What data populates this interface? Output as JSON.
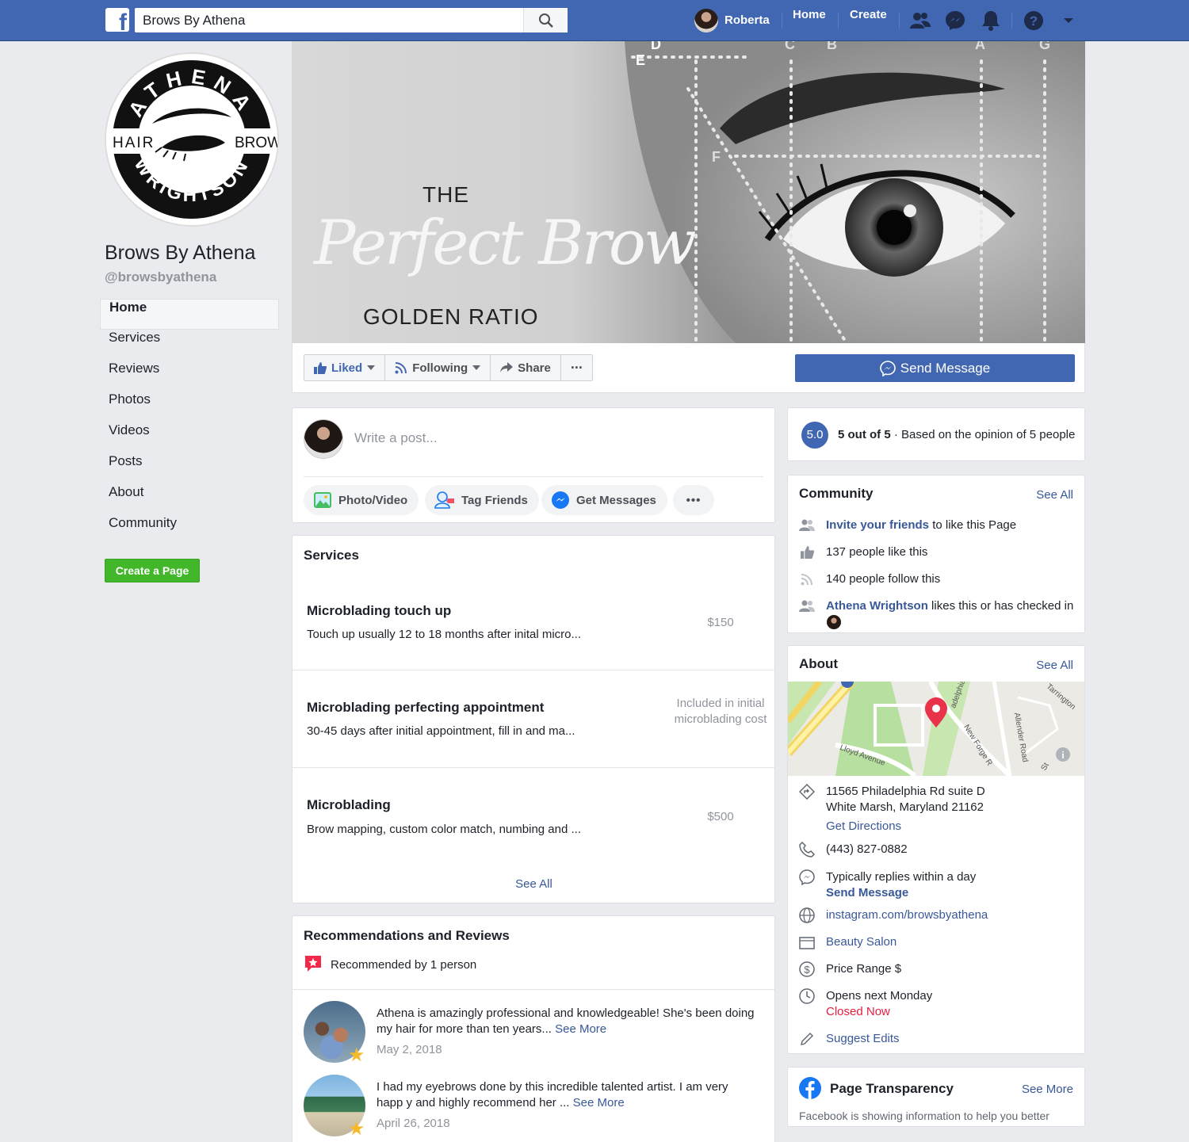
{
  "topbar": {
    "search_value": "Brows By Athena",
    "user_name": "Roberta",
    "home": "Home",
    "create": "Create"
  },
  "sidebar": {
    "page_name": "Brows By Athena",
    "handle": "@browsbyathena",
    "logo": {
      "top": "ATHENA",
      "left": "HAIR",
      "right": "BROW",
      "bottom": "WRIGHTSON"
    },
    "items": [
      {
        "label": "Home",
        "active": true
      },
      {
        "label": "Services"
      },
      {
        "label": "Reviews"
      },
      {
        "label": "Photos"
      },
      {
        "label": "Videos"
      },
      {
        "label": "Posts"
      },
      {
        "label": "About"
      },
      {
        "label": "Community"
      }
    ],
    "create_page": "Create a Page"
  },
  "cover": {
    "the": "THE",
    "script": "Perfect Brow",
    "golden": "GOLDEN RATIO",
    "letters": [
      "D",
      "E",
      "C",
      "B",
      "A",
      "G",
      "F"
    ]
  },
  "actions": {
    "liked": "Liked",
    "following": "Following",
    "share": "Share",
    "more": "···",
    "send_message": "Send Message"
  },
  "composer": {
    "placeholder": "Write a post...",
    "photo_video": "Photo/Video",
    "tag_friends": "Tag Friends",
    "get_messages": "Get Messages",
    "more": "•••"
  },
  "services": {
    "title": "Services",
    "items": [
      {
        "name": "Microblading touch up",
        "desc": "Touch up usually 12 to 18 months after inital micro...",
        "price": "$150"
      },
      {
        "name": "Microblading perfecting appointment",
        "desc": "30-45 days after initial appointment, fill in and ma...",
        "price": "Included in initial microblading cost"
      },
      {
        "name": "Microblading",
        "desc": "Brow mapping, custom color match, numbing and ...",
        "price": "$500"
      }
    ],
    "see_all": "See All"
  },
  "reviews": {
    "title": "Recommendations and Reviews",
    "recommended": "Recommended by 1 person",
    "items": [
      {
        "text": "Athena is amazingly professional and knowledgeable! She's been doing my hair for more than ten years...",
        "see_more": "See More",
        "date": "May 2, 2018"
      },
      {
        "text": "I had my eyebrows done by this incredible talented artist. I am very happ y and highly recommend her ...",
        "see_more": "See More",
        "date": "April 26, 2018"
      }
    ]
  },
  "rating": {
    "score": "5.0",
    "bold": "5 out of 5",
    "rest": " · Based on the opinion of 5 people"
  },
  "community": {
    "title": "Community",
    "see_all": "See All",
    "invite_link": "Invite your friends",
    "invite_rest": " to like this Page",
    "likes": "137 people like this",
    "follows": "140 people follow this",
    "friend_link": "Athena Wrightson",
    "friend_rest": " likes this or has checked in"
  },
  "about": {
    "title": "About",
    "see_all": "See All",
    "map_labels": [
      "Lloyd Avenue",
      "New Forge R",
      "Allender Road",
      "adelphia",
      "Tarrington",
      "St"
    ],
    "address_line1": "11565 Philadelphia Rd suite D",
    "address_line2": "White Marsh, Maryland 21162",
    "directions": "Get Directions",
    "phone": "(443) 827-0882",
    "replies": "Typically replies within a day",
    "send_message": "Send Message",
    "website": "instagram.com/browsbyathena",
    "category": "Beauty Salon",
    "price_range": "Price Range $",
    "opens": "Opens next Monday",
    "closed": "Closed Now",
    "suggest": "Suggest Edits"
  },
  "transparency": {
    "title": "Page Transparency",
    "see_more": "See More",
    "text": "Facebook is showing information to help you better understand the purpose of a Page. See actions taken by"
  },
  "colors": {
    "brand": "#4267b2",
    "link": "#385898",
    "green": "#42b72a",
    "closed": "#e41e3f"
  }
}
